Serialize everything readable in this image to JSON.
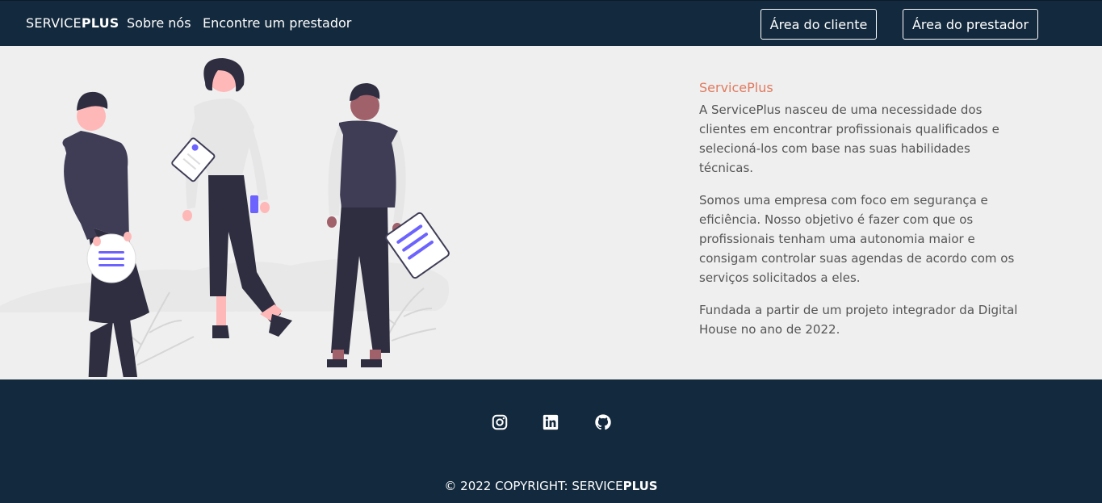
{
  "navbar": {
    "brand_prefix": "SERVICE",
    "brand_suffix": "PLUS",
    "links": [
      "Sobre nós",
      "Encontre um prestador"
    ],
    "client_area_label": "Área do cliente",
    "provider_area_label": "Área do prestador"
  },
  "about": {
    "title": "ServicePlus",
    "paragraphs": [
      "A ServicePlus nasceu de uma necessidade dos clientes em encontrar profissionais qualificados e selecioná-los com base nas suas habilidades técnicas.",
      "Somos uma empresa com foco em segurança e eficiência. Nosso objetivo é fazer com que os profissionais tenham uma autonomia maior e consigam controlar suas agendas de acordo com os serviços solicitados a eles.",
      "Fundada a partir de um projeto integrador da Digital House no ano de 2022."
    ]
  },
  "footer": {
    "social_icons": [
      "instagram-icon",
      "linkedin-icon",
      "github-icon"
    ],
    "copyright_prefix": "© 2022 COPYRIGHT: SERVICE",
    "copyright_suffix": "PLUS"
  },
  "colors": {
    "navbar_bg": "#13293d",
    "page_bg": "#efefef",
    "accent": "#e07a5f",
    "illustration_accent": "#6c63ff"
  }
}
